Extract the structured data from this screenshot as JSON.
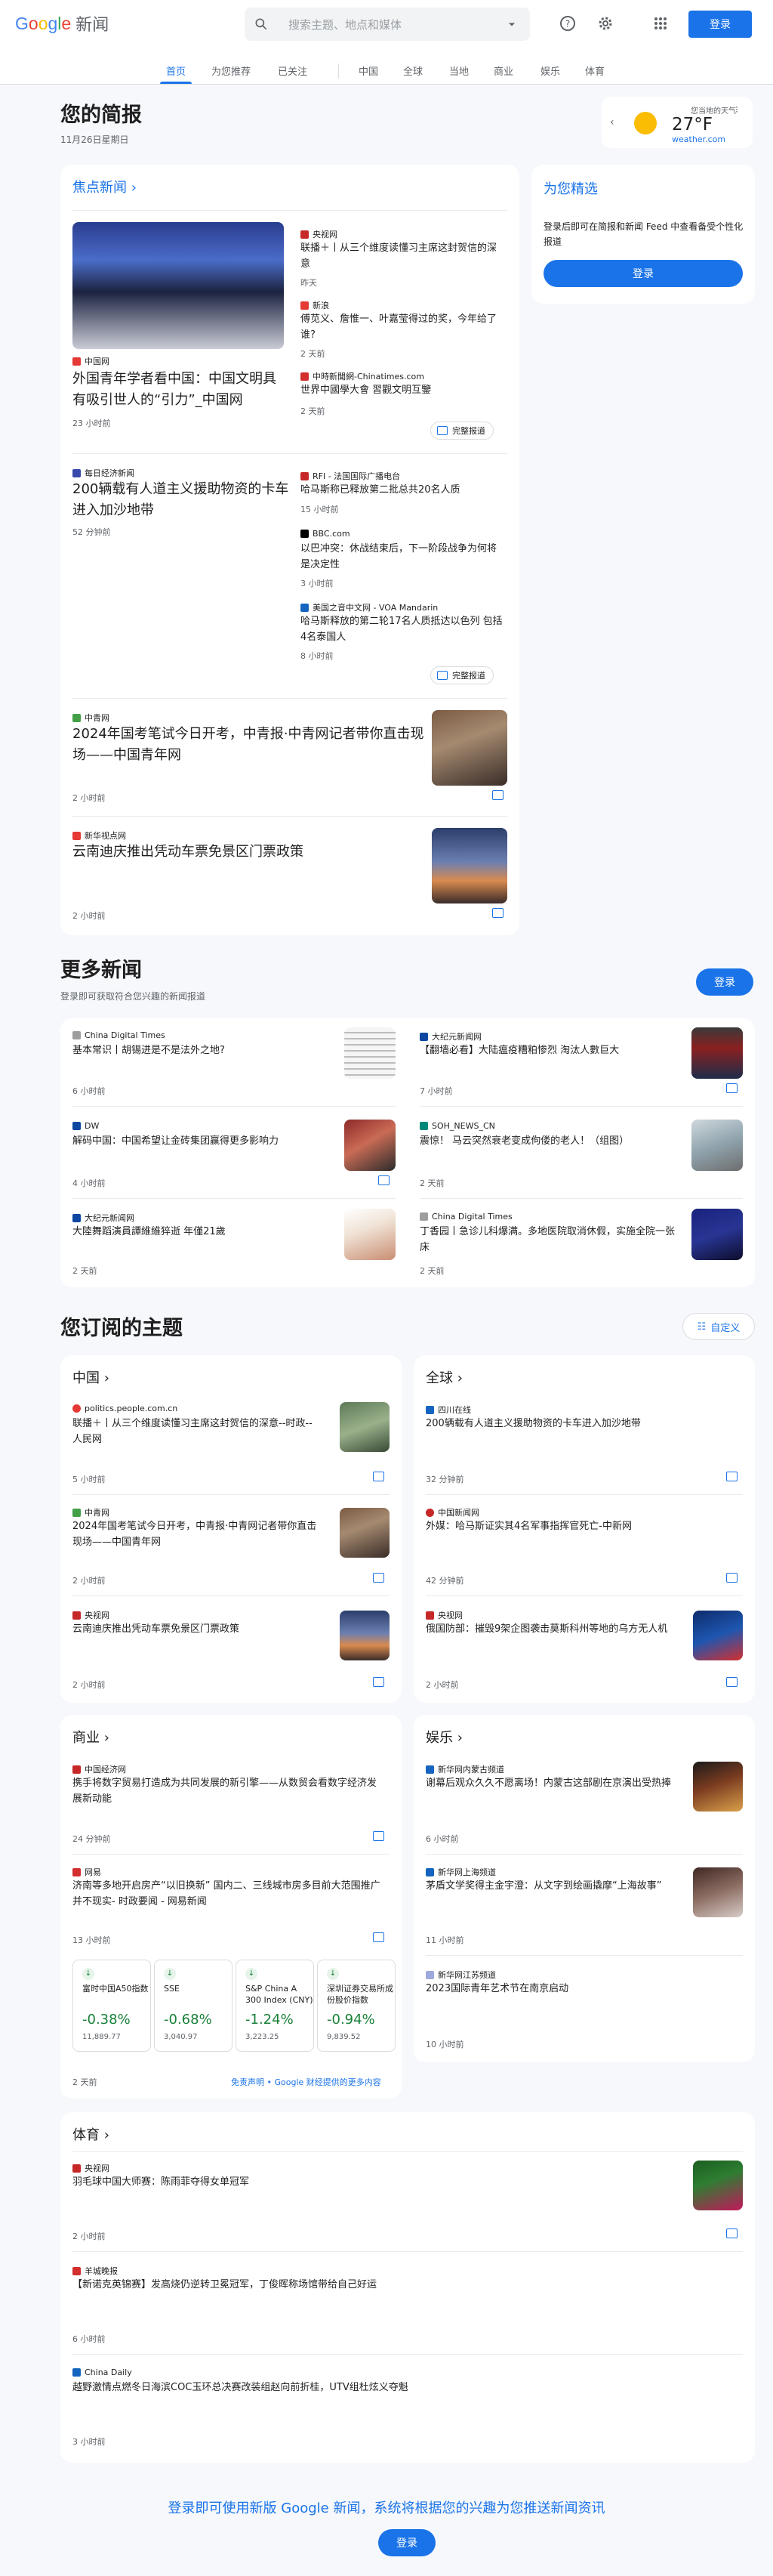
{
  "header": {
    "logo_google": "Google",
    "logo_news": "新闻",
    "search_placeholder": "搜索主题、地点和媒体",
    "signin": "登录",
    "tabs": [
      "首页",
      "为您推荐",
      "已关注",
      "中国",
      "全球",
      "当地",
      "商业",
      "娱乐",
      "体育"
    ]
  },
  "brief": {
    "title": "您的简报",
    "date": "11月26日星期日"
  },
  "weather": {
    "label": "您当地的天气",
    "temp": "27°F",
    "source": "weather.com"
  },
  "top": {
    "section": "焦点新闻",
    "c1": {
      "main_src": "中国网",
      "main_title": "外国青年学者看中国：中国文明具有吸引世人的“引力”_中国网",
      "main_time": "23 小时前",
      "side": [
        {
          "src": "央视网",
          "title": "联播＋丨从三个维度读懂习主席这封贺信的深意",
          "time": "昨天"
        },
        {
          "src": "新浪",
          "title": "傅苋义、詹惟一、叶嘉莹得过的奖，今年给了谁?",
          "time": "2 天前"
        },
        {
          "src": "中時新聞網-Chinatimes.com",
          "title": "世界中國學大會 習觀文明互鑒",
          "time": "2 天前"
        }
      ],
      "full": "完整报道"
    },
    "c2": {
      "main_src": "每日经济新闻",
      "main_title": "200辆载有人道主义援助物资的卡车进入加沙地带",
      "main_time": "52 分钟前",
      "side": [
        {
          "src": "RFI - 法国国际广播电台",
          "title": "哈马斯称已释放第二批总共20名人质",
          "time": "15 小时前"
        },
        {
          "src": "BBC.com",
          "title": "以巴冲突：休战结束后，下一阶段战争为何将是决定性",
          "time": "3 小时前"
        },
        {
          "src": "美国之音中文网 - VOA Mandarin",
          "title": "哈马斯释放的第二轮17名人质抵达以色列 包括4名泰国人",
          "time": "8 小时前"
        }
      ],
      "full": "完整报道"
    },
    "c3": {
      "src": "中青网",
      "title": "2024年国考笔试今日开考，中青报·中青网记者带你直击现场——中国青年网",
      "time": "2 小时前"
    },
    "c4": {
      "src": "新华视点网",
      "title": "云南迪庆推出凭动车票免景区门票政策",
      "time": "2 小时前"
    }
  },
  "picks": {
    "title": "为您精选",
    "desc": "登录后即可在简报和新闻 Feed 中查看备受个性化报道",
    "btn": "登录"
  },
  "more": {
    "title": "更多新闻",
    "sub": "登录即可获取符合您兴趣的新闻报道",
    "btn": "登录",
    "items": [
      {
        "src": "China Digital Times",
        "title": "基本常识丨胡锡进是不是法外之地?",
        "time": "6 小时前"
      },
      {
        "src": "大纪元新闻网",
        "title": "【翻墙必看】大陆瘟疫糟粕惨烈 淘汰人數巨大",
        "time": "7 小时前"
      },
      {
        "src": "DW",
        "title": "解码中国：中国希望让金砖集团赢得更多影响力",
        "time": "4 小时前"
      },
      {
        "src": "SOH_NEWS_CN",
        "title": "震惊！ 马云突然衰老变成佝偻的老人！（组图）",
        "time": "2 天前"
      },
      {
        "src": "大纪元新闻网",
        "title": "大陸舞蹈演員譚維維猝逝 年僅21歲",
        "time": "2 天前"
      },
      {
        "src": "China Digital Times",
        "title": "丁香园丨急诊儿科爆满。多地医院取消休假，实施全院一张床",
        "time": "2 天前"
      }
    ]
  },
  "topics": {
    "title": "您订阅的主题",
    "customize": "自定义",
    "china": {
      "name": "中国",
      "items": [
        {
          "src": "politics.people.com.cn",
          "title": "联播＋丨从三个维度读懂习主席这封贺信的深意--时政--人民网",
          "time": "5 小时前"
        },
        {
          "src": "中青网",
          "title": "2024年国考笔试今日开考，中青报·中青网记者带你直击现场——中国青年网",
          "time": "2 小时前"
        },
        {
          "src": "央视网",
          "title": "云南迪庆推出凭动车票免景区门票政策",
          "time": "2 小时前"
        }
      ]
    },
    "world": {
      "name": "全球",
      "items": [
        {
          "src": "四川在线",
          "title": "200辆载有人道主义援助物资的卡车进入加沙地带",
          "time": "32 分钟前"
        },
        {
          "src": "中国新闻网",
          "title": "外媒：哈马斯证实其4名军事指挥官死亡-中新网",
          "time": "42 分钟前"
        },
        {
          "src": "央视网",
          "title": "俄国防部：摧毁9架企图袭击莫斯科州等地的乌方无人机",
          "time": "2 小时前"
        }
      ]
    },
    "biz": {
      "name": "商业",
      "items": [
        {
          "src": "中国经济网",
          "title": "携手将数字贸易打造成为共同发展的新引擎——从数贸会看数字经济发展新动能",
          "time": "24 分钟前"
        },
        {
          "src": "网易",
          "title": "济南等多地开启房产“以旧换新” 国内二、三线城市房多目前大范围推广并不现实- 时政要闻 - 网易新闻",
          "time": "13 小时前"
        }
      ],
      "stocks": [
        {
          "name": "富时中国A50指数",
          "pct": "-0.38%",
          "val": "11,889.77"
        },
        {
          "name": "SSE",
          "pct": "-0.68%",
          "val": "3,040.97"
        },
        {
          "name": "S&P China A 300 Index (CNY)",
          "pct": "-1.24%",
          "val": "3,223.25"
        },
        {
          "name": "深圳证券交易所成份股价指数",
          "pct": "-0.94%",
          "val": "9,839.52"
        }
      ],
      "stocks_time": "2 天前",
      "disclaimer": "免责声明 • Google 财经提供的更多内容"
    },
    "ent": {
      "name": "娱乐",
      "items": [
        {
          "src": "新华网内蒙古频道",
          "title": "谢幕后观众久久不愿离场！内蒙古这部剧在京演出受热捧",
          "time": "6 小时前"
        },
        {
          "src": "新华网上海频道",
          "title": "茅盾文学奖得主金宇澄：从文字到绘画撬摩“上海故事”",
          "time": "11 小时前"
        },
        {
          "src": "新华网江苏频道",
          "title": "2023国际青年艺术节在南京启动",
          "time": "10 小时前"
        }
      ]
    },
    "sports": {
      "name": "体育",
      "items": [
        {
          "src": "央视网",
          "title": "羽毛球中国大师赛：陈雨菲夺得女单冠军",
          "time": "2 小时前"
        },
        {
          "src": "羊城晚报",
          "title": "【新诺克英锦赛】发高烧仍逆转卫冕冠军，丁俊晖称场馆带给自己好运",
          "time": "6 小时前"
        },
        {
          "src": "China Daily",
          "title": "越野激情点燃冬日海滨COC玉环总决赛改装组赵向前折桂，UTV组杜炫义夺魁",
          "time": "3 小时前"
        }
      ]
    }
  },
  "footer": {
    "text": "登录即可使用新版 Google 新闻，系统将根据您的兴趣为您推送新闻资讯",
    "btn": "登录"
  },
  "colors": {
    "accent": "#1a73e8",
    "green": "#188038"
  }
}
